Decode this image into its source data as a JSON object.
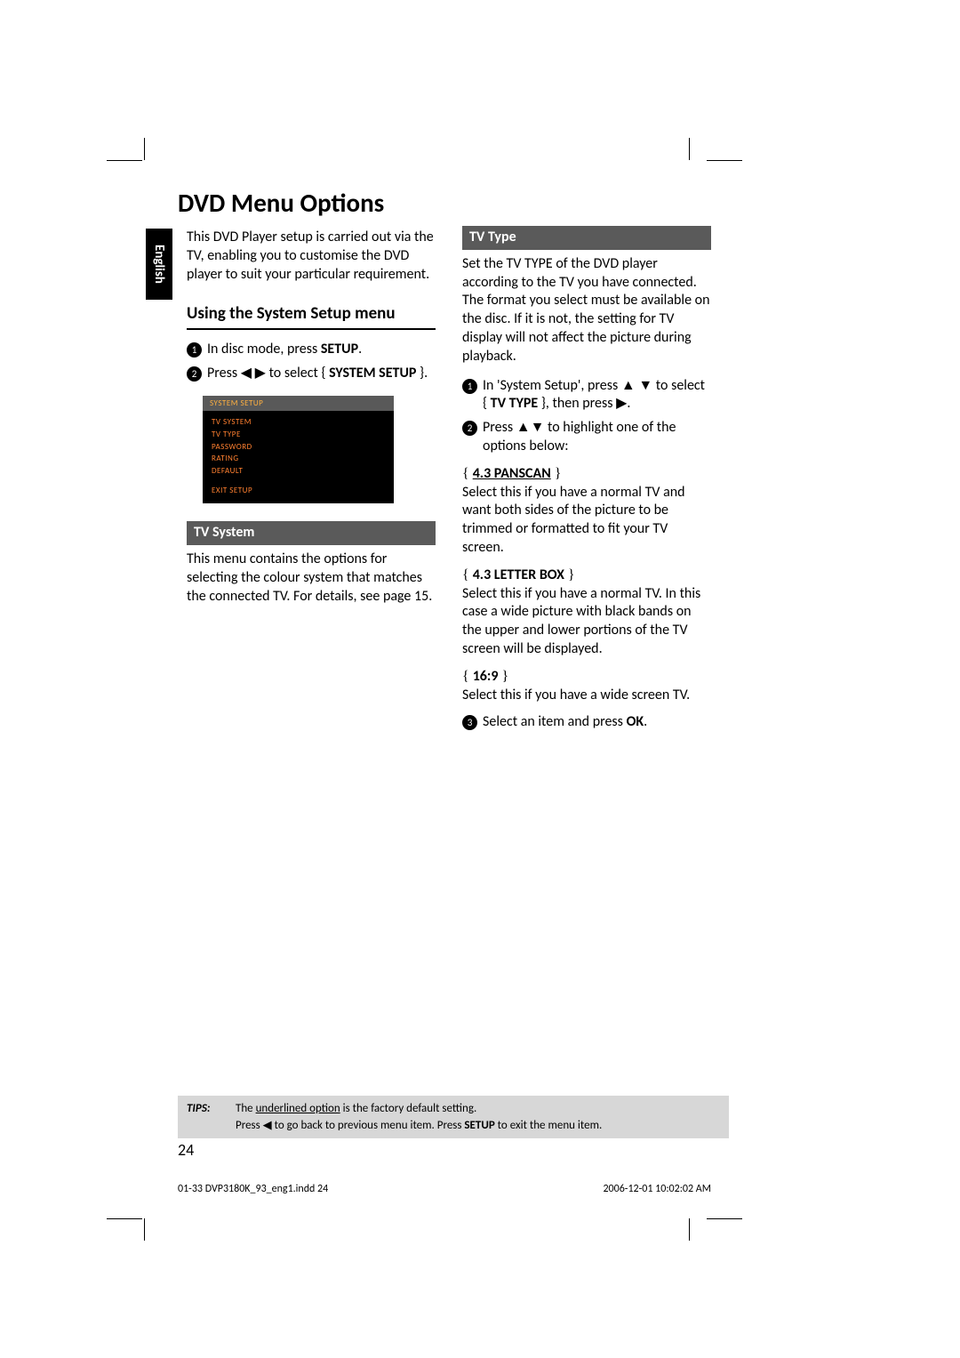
{
  "sideTab": "English",
  "pageTitle": "DVD Menu Options",
  "intro": "This DVD Player setup is carried out via the TV, enabling you to customise the DVD player to suit your particular requirement.",
  "sectionUsing": "Using the System Setup menu",
  "step1a": "In disc mode, press ",
  "step1b": "SETUP",
  "step1c": ".",
  "step2a": "Press ",
  "step2b": " to select { ",
  "step2c": "SYSTEM SETUP",
  "step2d": " }.",
  "osd": {
    "head": "SYSTEM SETUP",
    "items": [
      "TV SYSTEM",
      "TV TYPE",
      "PASSWORD",
      "RATING",
      "DEFAULT"
    ],
    "exit": "EXIT SETUP"
  },
  "tvSystemBar": "TV System",
  "tvSystemBody": "This menu contains the options for selecting the colour system that matches the connected TV. For details, see page 15.",
  "tvTypeBar": "TV  Type",
  "tvTypeBody": "Set the TV TYPE of the DVD player according to the TV you have connected. The format you select must be available on the disc. If it is not, the setting for TV display will not affect the picture during playback.",
  "r1a": "In 'System Setup', press ",
  "r1b": " to select { ",
  "r1c": "TV TYPE",
  "r1d": " }, then press ",
  "r1e": ".",
  "r2a": "Press ",
  "r2b": " to highlight one of the options below:",
  "panscanLabel": "4.3 PANSCAN",
  "panscanBody": "Select this if you have a normal TV and want both sides of the picture to be trimmed or formatted to fit your TV screen.",
  "letterLabel": "4.3 LETTER BOX",
  "letterBody": "Select this if you have a normal TV. In this case a wide picture with black bands on the upper and lower portions of the TV screen will be displayed.",
  "r169Label": "16:9",
  "r169Body": "Select this if you have a wide screen TV.",
  "r3a": "Select an item and press ",
  "r3b": "OK",
  "r3c": ".",
  "tipsLabel": "TIPS:",
  "tipsLine1a": "The ",
  "tipsLine1b": "underlined option",
  "tipsLine1c": " is the factory default setting.",
  "tipsLine2a": "Press ",
  "tipsLine2b": " to go back to previous menu item. Press ",
  "tipsLine2c": "SETUP",
  "tipsLine2d": " to exit the menu item.",
  "pageNumber": "24",
  "footerLeft": "01-33 DVP3180K_93_eng1.indd   24",
  "footerRight": "2006-12-01   10:02:02 AM"
}
